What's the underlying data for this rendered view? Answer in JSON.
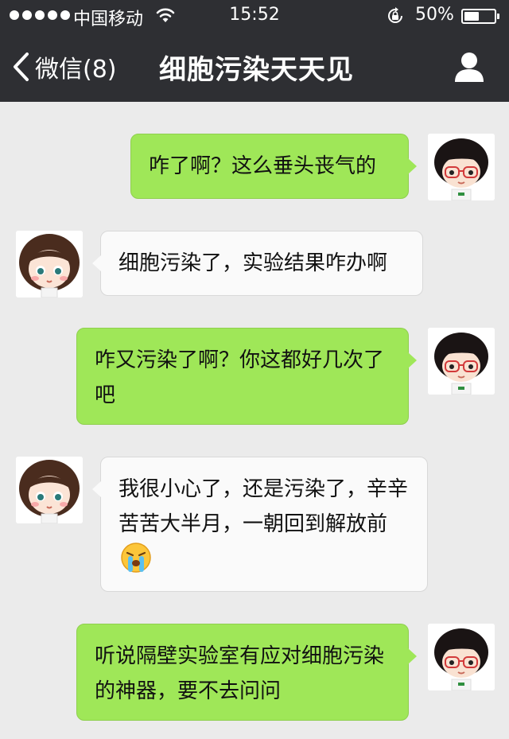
{
  "status_bar": {
    "carrier": "中国移动",
    "time": "15:52",
    "battery": "50%",
    "battery_level": 0.5
  },
  "nav": {
    "back_label": "微信(8)",
    "title": "细胞污染天天见"
  },
  "icons": {
    "back": "chevron-left-icon",
    "profile": "person-icon",
    "wifi": "wifi-icon",
    "rotation_lock": "rotation-lock-icon",
    "crying": "crying-face-emoji"
  },
  "colors": {
    "header": "#2e2f33",
    "background": "#ebebeb",
    "outgoing_bubble": "#9fe758",
    "incoming_bubble": "#fafafa"
  },
  "messages": [
    {
      "side": "right",
      "text": "咋了啊？这么垂头丧气的"
    },
    {
      "side": "left",
      "text": "细胞污染了，实验结果咋办啊"
    },
    {
      "side": "right",
      "text": "咋又污染了啊？你这都好几次了吧"
    },
    {
      "side": "left",
      "text": "我很小心了，还是污染了，辛辛苦苦大半月，一朝回到解放前",
      "emoji": "crying-face-emoji"
    },
    {
      "side": "right",
      "text": "听说隔壁实验室有应对细胞污染的神器，要不去问问"
    }
  ]
}
